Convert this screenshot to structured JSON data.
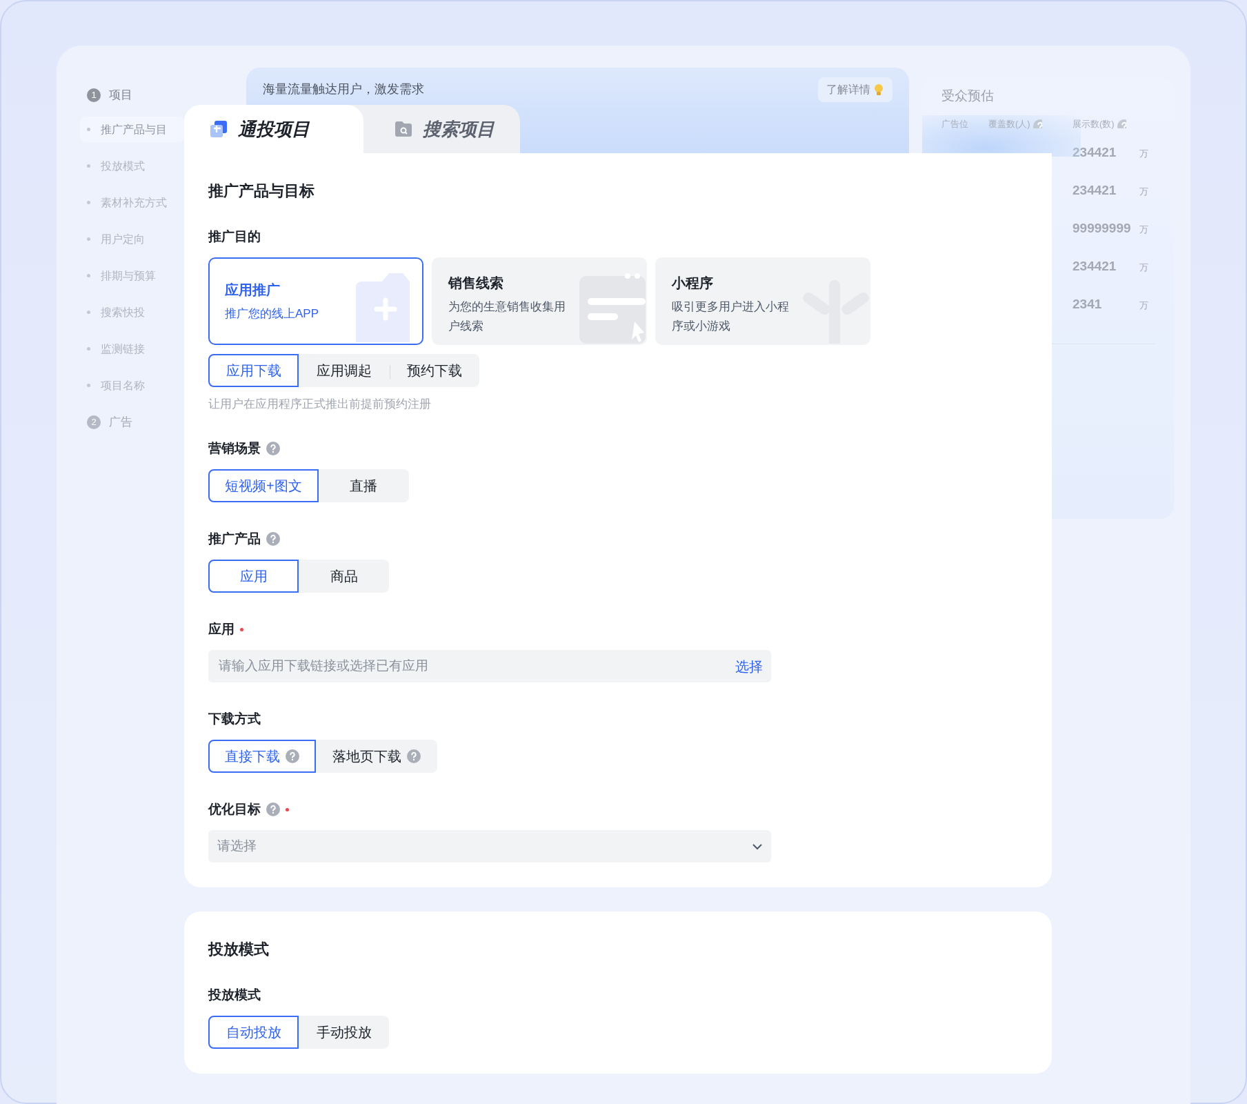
{
  "sidebar": [
    {
      "number": "1",
      "label": "项目",
      "enabled": true,
      "children": [
        {
          "label": "推广产品与目",
          "selected": true
        },
        {
          "label": "投放模式",
          "selected": false
        },
        {
          "label": "素材补充方式",
          "selected": false
        },
        {
          "label": "用户定向",
          "selected": false
        },
        {
          "label": "排期与预算",
          "selected": false
        },
        {
          "label": "搜索快投",
          "selected": false
        },
        {
          "label": "监测链接",
          "selected": false
        },
        {
          "label": "项目名称",
          "selected": false
        }
      ]
    },
    {
      "number": "2",
      "label": "广告",
      "enabled": false
    }
  ],
  "banner": {
    "text": "海量流量触达用户，激发需求",
    "button": "了解详情"
  },
  "audience": {
    "title": "受众预估",
    "columns": [
      {
        "label": "广告位"
      },
      {
        "label": "覆盖数(人)",
        "help": true
      },
      {
        "label": "展示数(数)",
        "help": true
      }
    ],
    "rows": [
      {
        "value": "234421",
        "unit": "万"
      },
      {
        "value": "234421",
        "unit": "万"
      },
      {
        "value": "99999999",
        "unit": "万"
      },
      {
        "value": "234421",
        "unit": "万"
      },
      {
        "value": "2341",
        "unit": "万"
      }
    ]
  },
  "tabs": [
    {
      "label": "通投项目",
      "selected": true
    },
    {
      "label": "搜索项目",
      "selected": false
    }
  ],
  "sections": [
    {
      "title": "推广产品与目标",
      "fields": [
        {
          "kind": "cards",
          "label": "推广目的",
          "options": [
            {
              "title": "应用推广",
              "description": "推广您的线上APP",
              "selected": true
            },
            {
              "title": "销售线索",
              "description": "为您的生意销售收集用户线索",
              "selected": false
            },
            {
              "title": "小程序",
              "description": "吸引更多用户进入小程序或小游戏",
              "selected": false
            }
          ]
        },
        {
          "kind": "segmented",
          "options": [
            {
              "label": "应用下载",
              "selected": true
            },
            {
              "label": "应用调起",
              "selected": false
            },
            {
              "label": "预约下载",
              "selected": false
            }
          ],
          "hint": "让用户在应用程序正式推出前提前预约注册"
        },
        {
          "kind": "segmented",
          "label": "营销场景",
          "help": true,
          "options": [
            {
              "label": "短视频+图文",
              "selected": true
            },
            {
              "label": "直播",
              "selected": false
            }
          ]
        },
        {
          "kind": "segmented",
          "label": "推广产品",
          "help": true,
          "options": [
            {
              "label": "应用",
              "selected": true
            },
            {
              "label": "商品",
              "selected": false
            }
          ]
        },
        {
          "kind": "input",
          "label": "应用",
          "required": true,
          "placeholder": "请输入应用下载链接或选择已有应用",
          "action": "选择"
        },
        {
          "kind": "segmented",
          "label": "下载方式",
          "options": [
            {
              "label": "直接下载",
              "selected": true,
              "help": true
            },
            {
              "label": "落地页下载",
              "selected": false,
              "help": true
            }
          ]
        },
        {
          "kind": "select",
          "label": "优化目标",
          "help": true,
          "required": true,
          "placeholder": "请选择"
        }
      ]
    },
    {
      "title": "投放模式",
      "fields": [
        {
          "kind": "segmented",
          "label": "投放模式",
          "options": [
            {
              "label": "自动投放",
              "selected": true
            },
            {
              "label": "手动投放",
              "selected": false
            }
          ]
        }
      ]
    }
  ]
}
